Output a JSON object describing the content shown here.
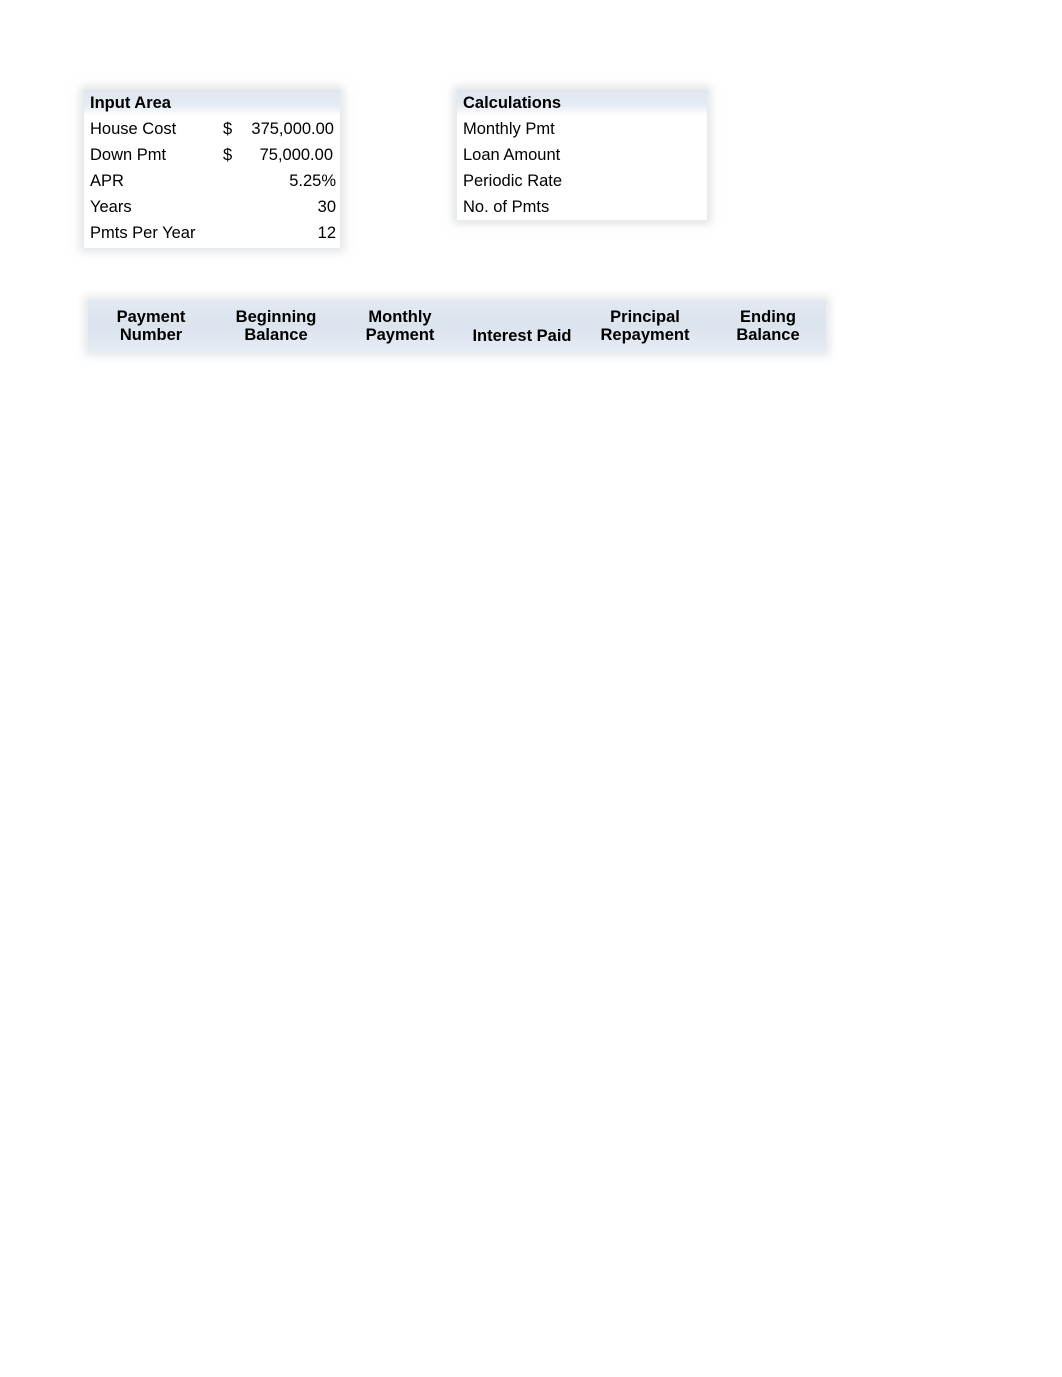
{
  "input_area": {
    "title": "Input Area",
    "rows": [
      {
        "label": "House Cost",
        "currency": "$",
        "value": "375,000.00"
      },
      {
        "label": "Down Pmt",
        "currency": "$",
        "value": "75,000.00"
      },
      {
        "label": "APR",
        "currency": "",
        "value": "5.25%"
      },
      {
        "label": "Years",
        "currency": "",
        "value": "30"
      },
      {
        "label": "Pmts Per Year",
        "currency": "",
        "value": "12"
      }
    ]
  },
  "calculations": {
    "title": "Calculations",
    "rows": [
      {
        "label": "Monthly Pmt"
      },
      {
        "label": "Loan Amount"
      },
      {
        "label": "Periodic Rate"
      },
      {
        "label": "No. of Pmts"
      }
    ]
  },
  "schedule": {
    "columns": [
      {
        "line1": "Payment",
        "line2": "Number"
      },
      {
        "line1": "Beginning",
        "line2": "Balance"
      },
      {
        "line1": "Monthly",
        "line2": "Payment"
      },
      {
        "line1": "",
        "line2": "Interest Paid"
      },
      {
        "line1": "Principal",
        "line2": "Repayment"
      },
      {
        "line1": "Ending",
        "line2": "Balance"
      }
    ]
  }
}
